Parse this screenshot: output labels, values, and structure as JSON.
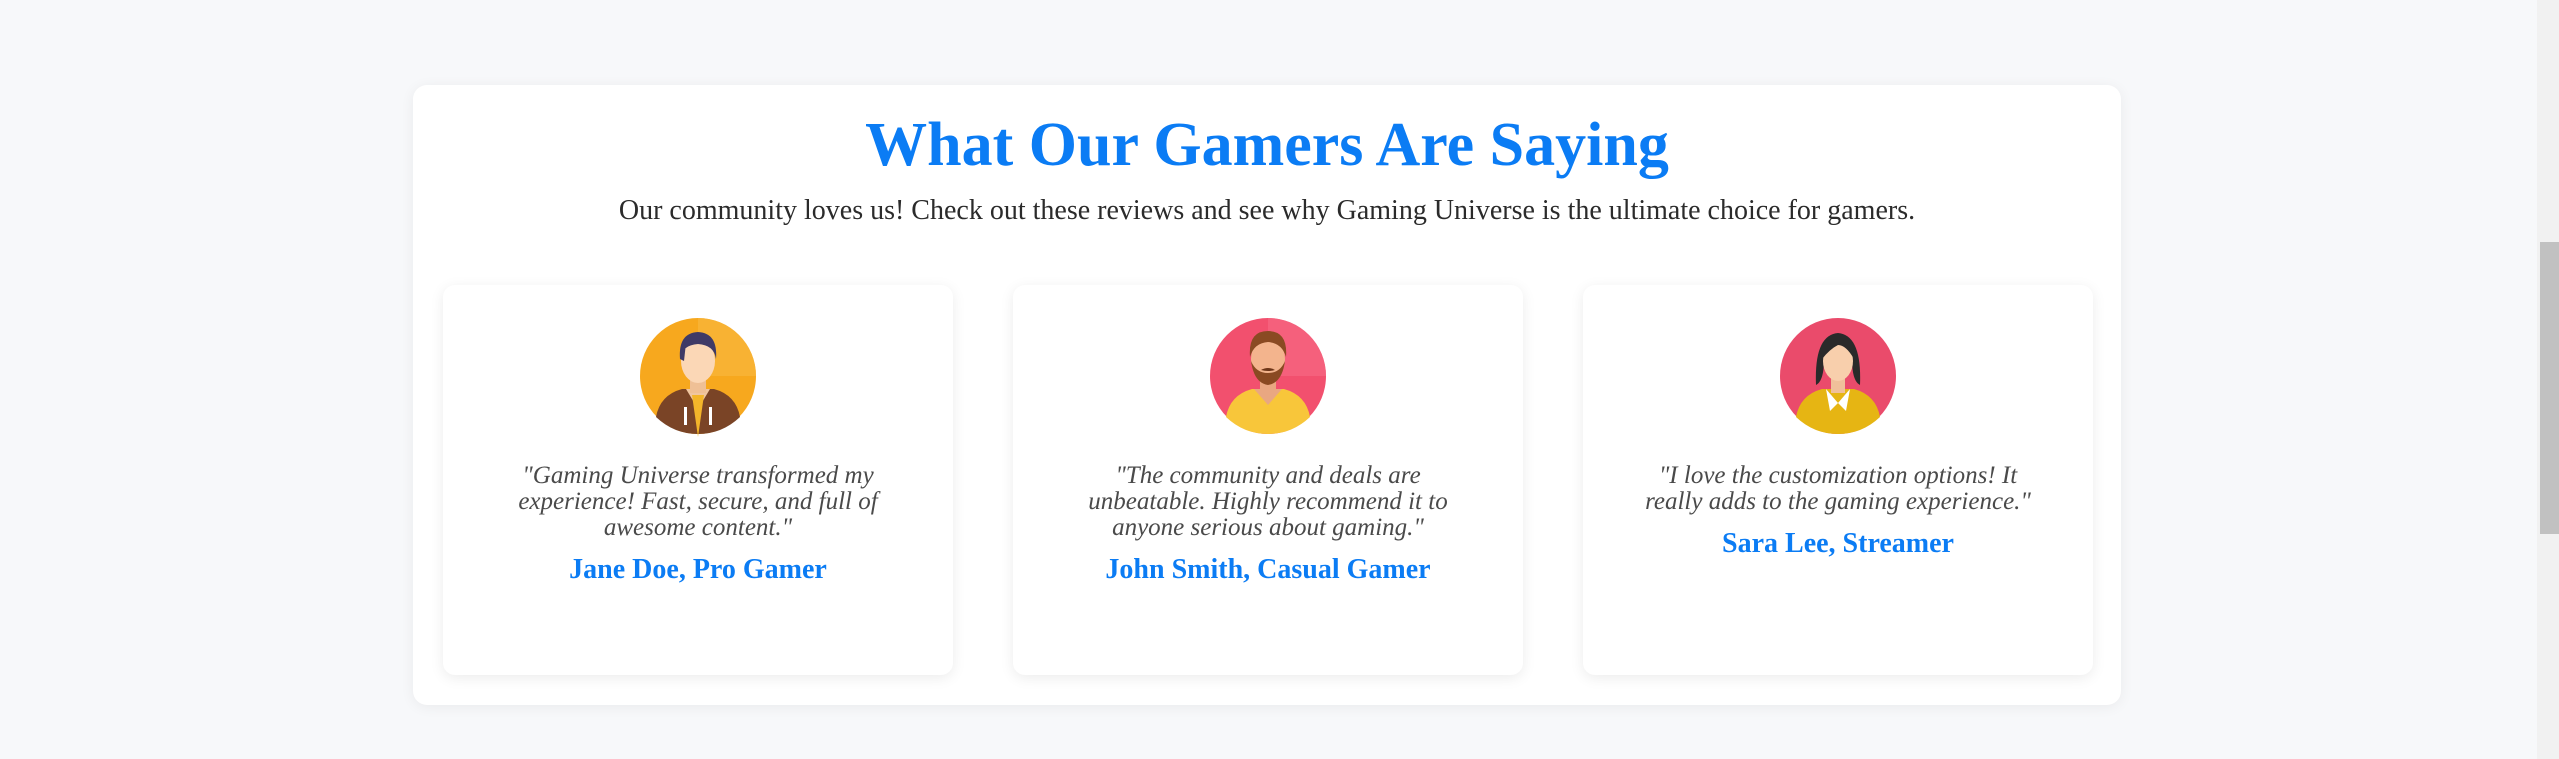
{
  "section": {
    "title": "What Our Gamers Are Saying",
    "subtitle": "Our community loves us! Check out these reviews and see why Gaming Universe is the ultimate choice for gamers."
  },
  "testimonials": [
    {
      "quote": "\"Gaming Universe transformed my experience! Fast, secure, and full of awesome content.\"",
      "author": "Jane Doe, Pro Gamer",
      "avatar_icon": "male-gamer-avatar-icon"
    },
    {
      "quote": "\"The community and deals are unbeatable. Highly recommend it to anyone serious about gaming.\"",
      "author": "John Smith, Casual Gamer",
      "avatar_icon": "bearded-man-avatar-icon"
    },
    {
      "quote": "\"I love the customization options! It really adds to the gaming experience.\"",
      "author": "Sara Lee, Streamer",
      "avatar_icon": "woman-avatar-icon"
    }
  ],
  "colors": {
    "accent": "#0b7cf4",
    "page_background": "#f7f8fa",
    "card_background": "#ffffff",
    "quote_text": "#4a4a4a"
  }
}
